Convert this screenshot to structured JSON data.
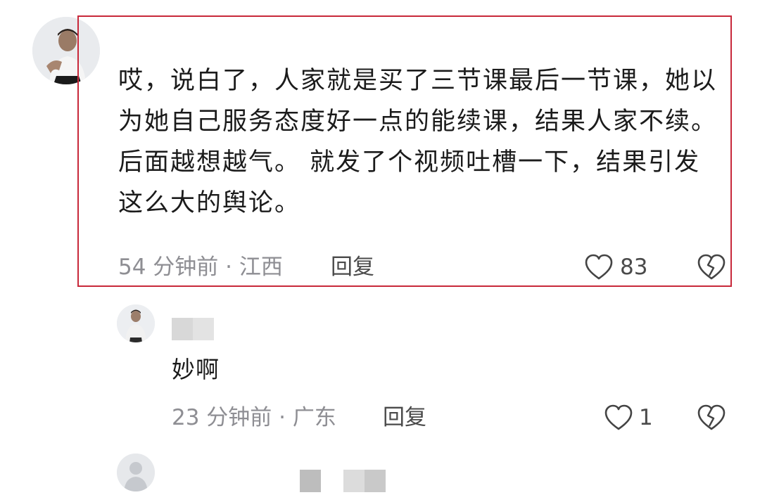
{
  "main_comment": {
    "text": "哎，说白了，人家就是买了三节课最后一节课，她以为她自己服务态度好一点的能续课，结果人家不续。后面越想越气。 就发了个视频吐槽一下，结果引发这么大的舆论。",
    "meta": "54 分钟前 · 江西",
    "reply_label": "回复",
    "like_count": "83",
    "like_icon": "heart-outline-icon",
    "dislike_icon": "broken-heart-icon",
    "highlight_color": "#c8283a"
  },
  "reply_comment": {
    "text": "妙啊",
    "meta": "23 分钟前 · 广东",
    "reply_label": "回复",
    "like_count": "1",
    "like_icon": "heart-outline-icon",
    "dislike_icon": "broken-heart-icon"
  },
  "colors": {
    "text": "#1b1b1b",
    "meta": "#8e8e93",
    "icon": "#444444"
  }
}
